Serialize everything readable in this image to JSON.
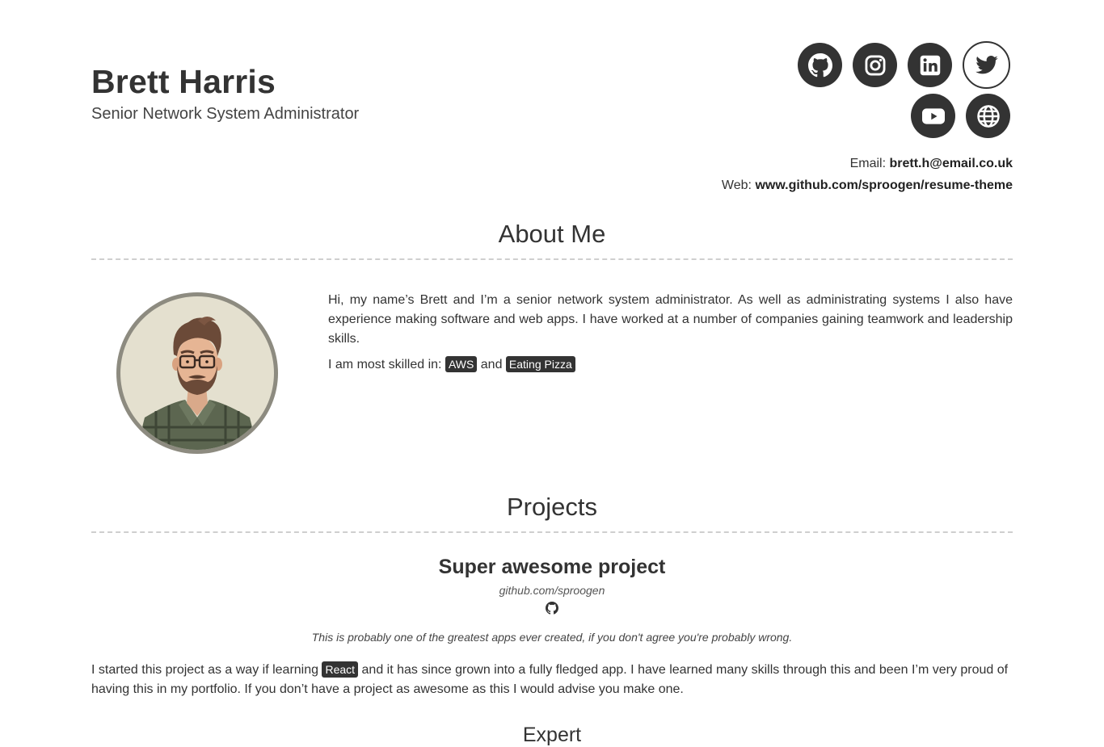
{
  "header": {
    "name": "Brett Harris",
    "title": "Senior Network System Administrator"
  },
  "socials": [
    {
      "name": "github",
      "icon": "github-icon"
    },
    {
      "name": "instagram",
      "icon": "instagram-icon"
    },
    {
      "name": "linkedin",
      "icon": "linkedin-icon"
    },
    {
      "name": "twitter",
      "icon": "twitter-icon"
    },
    {
      "name": "youtube",
      "icon": "youtube-icon"
    },
    {
      "name": "website",
      "icon": "globe-icon"
    }
  ],
  "contact": {
    "email_label": "Email:",
    "email_value": "brett.h@email.co.uk",
    "web_label": "Web:",
    "web_value": "www.github.com/sproogen/resume-theme"
  },
  "about": {
    "heading": "About Me",
    "paragraph": "Hi, my name’s Brett and I’m a senior network system administrator. As well as administrating systems I also have experience making software and web apps. I have worked at a number of companies gaining teamwork and leadership skills.",
    "skills_prefix": "I am most skilled in:",
    "skills": [
      "AWS",
      "Eating Pizza"
    ],
    "skills_joiner": "and"
  },
  "projects": {
    "heading": "Projects",
    "items": [
      {
        "title": "Super awesome project",
        "url": "github.com/sproogen",
        "tagline": "This is probably one of the greatest apps ever created, if you don't agree you're probably wrong.",
        "desc_before": "I started this project as a way if learning",
        "desc_badge": "React",
        "desc_after": "and it has since grown into a fully fledged app. I have learned many skills through this and been I’m very proud of having this in my portfolio. If you don’t have a project as awesome as this I would advise you make one."
      }
    ],
    "next_heading_partial": "Expert"
  },
  "colors": {
    "text": "#333333",
    "badge_bg": "#333333",
    "divider": "#cfcfcf",
    "avatar_ring": "#8d8b80",
    "avatar_bg": "#e4e0cf"
  }
}
